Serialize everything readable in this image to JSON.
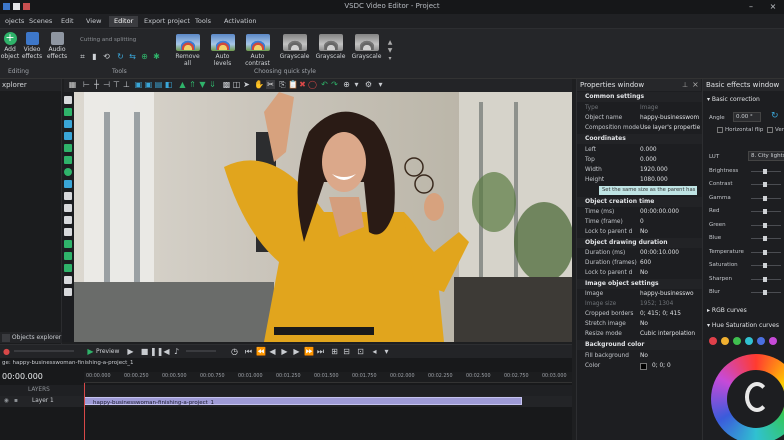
{
  "titlebar": {
    "title": "VSDC Video Editor - Project"
  },
  "menu": {
    "items": [
      "ojects",
      "Scenes",
      "Edit",
      "View",
      "Editor",
      "Export project",
      "Tools",
      "Activation"
    ],
    "active_index": 4
  },
  "ribbon": {
    "add_object": "Add object",
    "video_effects": "Video effects",
    "audio_effects": "Audio effects",
    "cutting": "Cutting and splitting",
    "group_editing": "Editing",
    "group_tools": "Tools",
    "group_quick_style": "Choosing quick style",
    "quick_styles": [
      "Remove all",
      "Auto levels",
      "Auto contrast",
      "Grayscale",
      "Grayscale",
      "Grayscale"
    ]
  },
  "left_panel": {
    "title": "xplorer",
    "tab_objects": "Objects explorer"
  },
  "properties": {
    "title": "Properties window",
    "common": "Common settings",
    "type_label": "Type",
    "type_value": "Image",
    "name_label": "Object name",
    "name_value": "happy-businesswom",
    "comp_label": "Composition mode",
    "comp_value": "Use layer's properties",
    "coords": "Coordinates",
    "left_label": "Left",
    "left_value": "0.000",
    "top_label": "Top",
    "top_value": "0.000",
    "width_label": "Width",
    "width_value": "1920.000",
    "height_label": "Height",
    "height_value": "1080.000",
    "parent_btn": "Set the same size as the parent has",
    "creation": "Object creation time",
    "time_ms_label": "Time (ms)",
    "time_ms_value": "00:00:00.000",
    "time_frame_label": "Time (frame)",
    "time_frame_value": "0",
    "lock1_label": "Lock to parent d",
    "lock1_value": "No",
    "drawing": "Object drawing duration",
    "dur_ms_label": "Duration (ms)",
    "dur_ms_value": "00:00:10.000",
    "dur_fr_label": "Duration (frames)",
    "dur_fr_value": "600",
    "lock2_label": "Lock to parent d",
    "lock2_value": "No",
    "image_settings": "Image object settings",
    "image_label": "Image",
    "image_value": "happy-businesswo",
    "imgsize_label": "Image size",
    "imgsize_value": "1952; 1304",
    "crop_label": "Cropped borders",
    "crop_value": "0; 415; 0; 415",
    "stretch_label": "Stretch image",
    "stretch_value": "No",
    "resize_label": "Resize mode",
    "resize_value": "Cubic interpolation",
    "bg": "Background color",
    "fill_label": "Fill background",
    "fill_value": "No",
    "color_label": "Color",
    "color_value": "0; 0; 0"
  },
  "effects": {
    "title": "Basic effects window",
    "basic": "Basic correction",
    "angle_label": "Angle",
    "angle_value": "0.00 °",
    "hflip": "Horizontal flip",
    "vflip": "Ver",
    "lut_label": "LUT",
    "lut_value": "8. City lights",
    "sliders": [
      "Brightness",
      "Contrast",
      "Gamma",
      "Red",
      "Green",
      "Blue",
      "Temperature",
      "Saturation",
      "Sharpen",
      "Blur"
    ],
    "rgb": "RGB curves",
    "hue": "Hue Saturation curves",
    "swatches": [
      "#e0404a",
      "#f0b030",
      "#3fbf4f",
      "#31c1d1",
      "#4a6fe0",
      "#c64ad8"
    ]
  },
  "timeline": {
    "preview_label": "Preview",
    "path": "ge: happy-businesswoman-finishing-a-project_1",
    "timecode": "00:00.000",
    "ruler": [
      "00:00.000",
      "00:00.250",
      "00:00.500",
      "00:00.750",
      "00:01.000",
      "00:01.250",
      "00:01.500",
      "00:01.750",
      "00:02.000",
      "00:02.250",
      "00:02.500",
      "00:02.750",
      "00:03.000"
    ],
    "layers_label": "LAYERS",
    "layer1": "Layer 1",
    "clip_name": "happy-businesswoman-finishing-a-project_1"
  },
  "colors": {
    "accent": "#2fb36a",
    "clip": "#9e9ad6",
    "panel": "#1d1e21"
  }
}
